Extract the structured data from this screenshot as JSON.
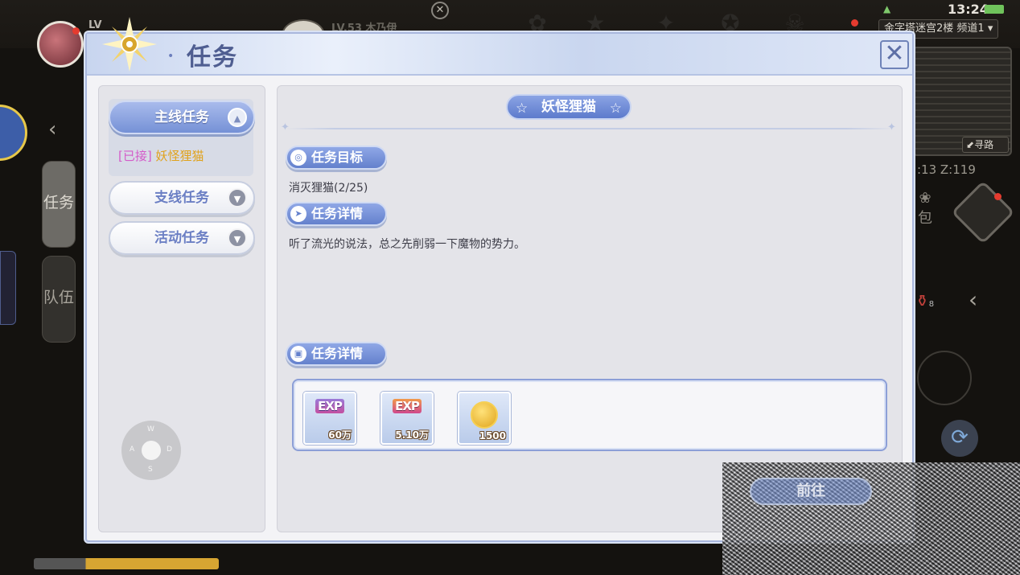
{
  "hud": {
    "level_prefix": "LV",
    "player_info": "LV.53 木乃伊",
    "time": "13:24",
    "location": "金字塔迷宫2楼",
    "channel": "频道1",
    "seek_path": "寻路",
    "coords": ":13  Z:119",
    "bag_label": "包",
    "side_tabs": [
      {
        "label": "任务"
      },
      {
        "label": "队伍"
      }
    ],
    "potion_count": "8"
  },
  "panel": {
    "title": "任务",
    "close_glyph": "✕"
  },
  "nav": {
    "categories": [
      {
        "label": "主线任务",
        "toggle": "▲"
      },
      {
        "label": "支线任务",
        "toggle": "▼"
      },
      {
        "label": "活动任务",
        "toggle": "▼"
      }
    ],
    "active_quest": {
      "tag": "[已接]",
      "name": "妖怪狸猫"
    }
  },
  "joystick": {
    "w": "W",
    "a": "A",
    "s": "S",
    "d": "D"
  },
  "detail": {
    "quest_name": "妖怪狸猫",
    "objective_title": "任务目标",
    "objective_text": "消灭狸猫(2/25)",
    "details_title": "任务详情",
    "details_text": "听了流光的说法，总之先削弱一下魔物的势力。",
    "rewards_title": "任务详情",
    "rewards": [
      {
        "icon": "exp-book-icon",
        "badge": "EXP",
        "amount": "60万"
      },
      {
        "icon": "exp-star-icon",
        "badge": "EXP",
        "amount": "5.10万"
      },
      {
        "icon": "zeny-coin-icon",
        "amount": "1500"
      }
    ],
    "action_button": "前往"
  },
  "colors": {
    "accent": "#6481cd",
    "quest_tag": "#d45cc9",
    "quest_name": "#e0a21b"
  }
}
